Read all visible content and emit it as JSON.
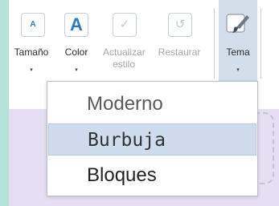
{
  "ribbon": {
    "buttons": [
      {
        "label": "Tamaño",
        "icon": "font-size-small-icon",
        "glyph": "A",
        "has_dropdown": true
      },
      {
        "label": "Color",
        "icon": "font-color-icon",
        "glyph": "A",
        "has_dropdown": true
      },
      {
        "label": "Actualizar estilo",
        "icon": "checkmark-icon",
        "glyph": "✓",
        "disabled": true
      },
      {
        "label": "Restaurar",
        "icon": "undo-icon",
        "glyph": "↺",
        "disabled": true
      },
      {
        "label": "Tema",
        "icon": "paintbrush-icon",
        "has_dropdown": true,
        "selected": true
      }
    ],
    "dropdown_glyph": "▾"
  },
  "theme_menu": {
    "items": [
      {
        "label": "Moderno",
        "selected": false
      },
      {
        "label": "Burbuja",
        "selected": true
      },
      {
        "label": "Bloques",
        "selected": false
      }
    ]
  },
  "colors": {
    "accent_blue": "#2b78c5",
    "menu_selected_bg": "#cfdced",
    "background_teal": "#b6e3d9",
    "content_purple": "#e6dff3"
  }
}
